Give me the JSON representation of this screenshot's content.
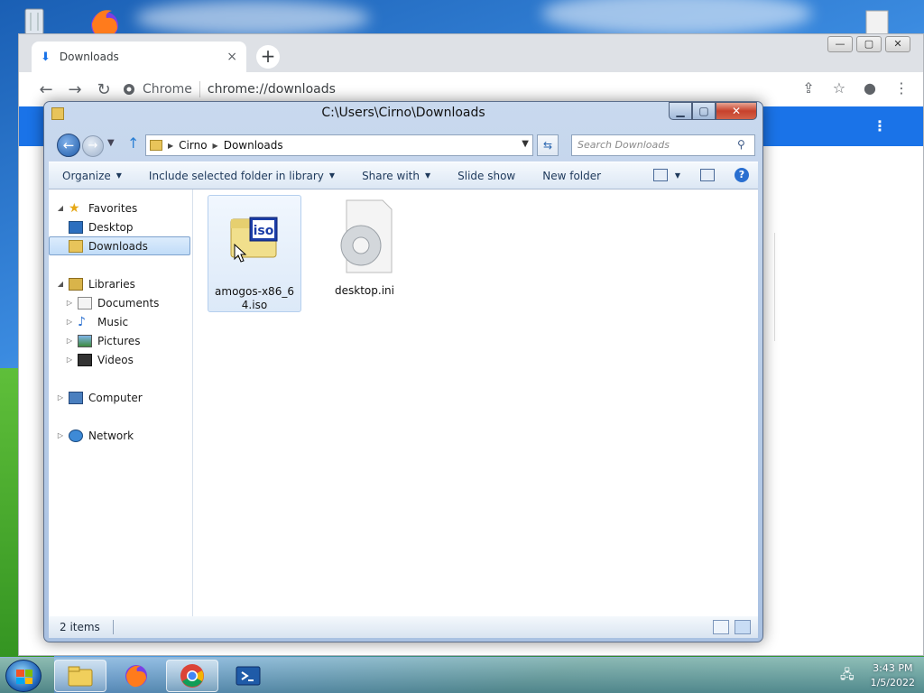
{
  "chrome": {
    "tab_title": "Downloads",
    "tab_close": "×",
    "new_tab": "+",
    "site_chip": "Chrome",
    "url": "chrome://downloads",
    "win_min": "—",
    "win_max": "▢",
    "win_close": "✕",
    "menu": "⋮"
  },
  "explorer": {
    "title": "C:\\Users\\Cirno\\Downloads",
    "controls": {
      "min": "▁",
      "max": "▢",
      "close": "✕"
    },
    "address": {
      "crumbs": [
        "Cirno",
        "Downloads"
      ]
    },
    "search_placeholder": "Search Downloads",
    "commands": {
      "organize": "Organize",
      "include": "Include selected folder in library",
      "share": "Share with",
      "slideshow": "Slide show",
      "newfolder": "New folder"
    },
    "nav": {
      "favorites": "Favorites",
      "desktop": "Desktop",
      "downloads": "Downloads",
      "libraries": "Libraries",
      "documents": "Documents",
      "music": "Music",
      "pictures": "Pictures",
      "videos": "Videos",
      "computer": "Computer",
      "network": "Network"
    },
    "files": [
      {
        "name": "amogos-x86_64.iso",
        "icon": "iso-file-icon",
        "badge": "iso",
        "selected": true
      },
      {
        "name": "desktop.ini",
        "icon": "settings-file-icon",
        "selected": false
      }
    ],
    "status": "2 items"
  },
  "taskbar": {
    "time": "3:43 PM",
    "date": "1/5/2022"
  }
}
